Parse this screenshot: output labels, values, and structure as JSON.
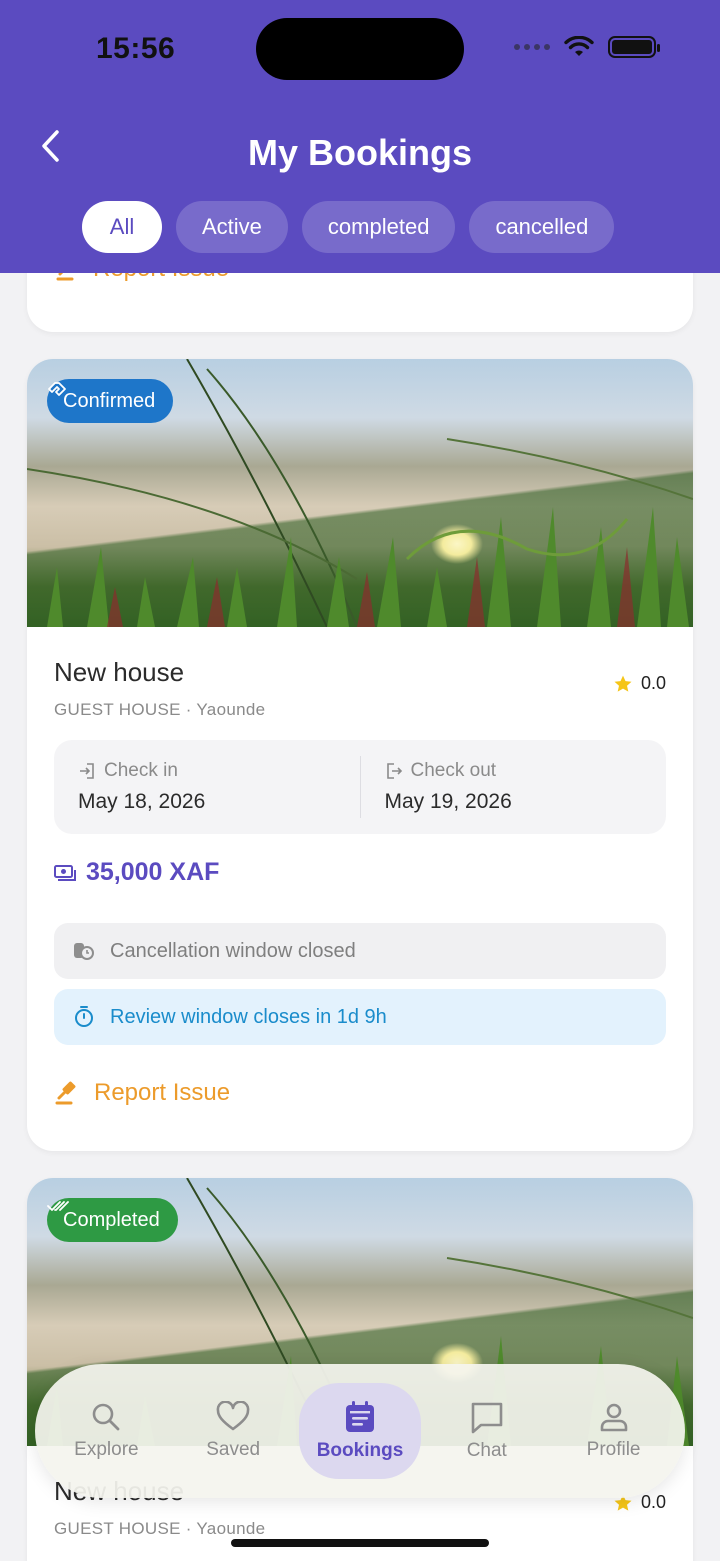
{
  "status_bar": {
    "time": "15:56"
  },
  "header": {
    "title": "My Bookings",
    "tabs": [
      "All",
      "Active",
      "completed",
      "cancelled"
    ],
    "active_tab": "All"
  },
  "top_card": {
    "report_label": "Report Issue"
  },
  "bookings": [
    {
      "status": "Confirmed",
      "name": "New house",
      "subtitle": "GUEST HOUSE · Yaounde",
      "rating": "0.0",
      "check_in_label": "Check in",
      "check_in": "May 18, 2026",
      "check_out_label": "Check out",
      "check_out": "May 19, 2026",
      "price": "35,000 XAF",
      "cancellation_notice": "Cancellation window closed",
      "review_notice": "Review window closes in 1d 9h",
      "report_label": "Report Issue"
    },
    {
      "status": "Completed",
      "name": "New house",
      "subtitle": "GUEST HOUSE · Yaounde",
      "rating": "0.0"
    }
  ],
  "nav": {
    "items": [
      "Explore",
      "Saved",
      "Bookings",
      "Chat",
      "Profile"
    ],
    "active": "Bookings"
  },
  "colors": {
    "primary": "#5b4bc0",
    "confirmed": "#1e76c9",
    "completed": "#2e9a44",
    "warning": "#ec9b2b",
    "info": "#1a8ccb",
    "star": "#f5c518"
  },
  "icons": [
    "back-chevron-icon",
    "wifi-icon",
    "battery-icon",
    "report-hammer-icon",
    "star-icon",
    "login-icon",
    "logout-icon",
    "money-icon",
    "timer-lock-icon",
    "stopwatch-icon",
    "handshake-icon",
    "double-check-icon",
    "search-icon",
    "heart-icon",
    "calendar-icon",
    "chat-icon",
    "person-icon"
  ]
}
